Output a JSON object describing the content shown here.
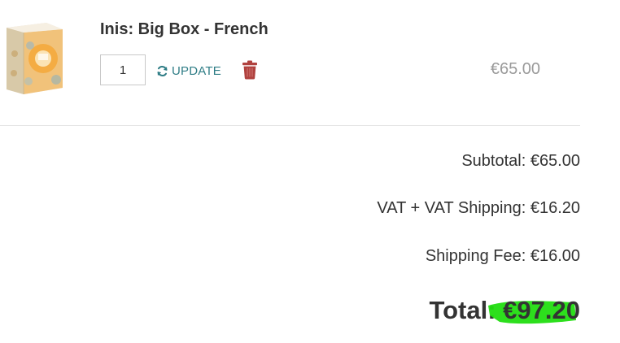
{
  "cart_item": {
    "title": "Inis: Big Box - French",
    "quantity": "1",
    "update_label": "UPDATE",
    "price": "€65.00",
    "icons": {
      "update": "refresh-icon",
      "delete": "trash-icon"
    }
  },
  "totals": {
    "subtotal": "Subtotal: €65.00",
    "vat": "VAT + VAT Shipping: €16.20",
    "shipping": "Shipping Fee: €16.00",
    "total_label": "Total: ",
    "total_value": "€97.20"
  },
  "colors": {
    "accent": "#2f7d86",
    "delete": "#b0413e",
    "highlight": "#22dd11",
    "price_muted": "#9a9a9a"
  }
}
